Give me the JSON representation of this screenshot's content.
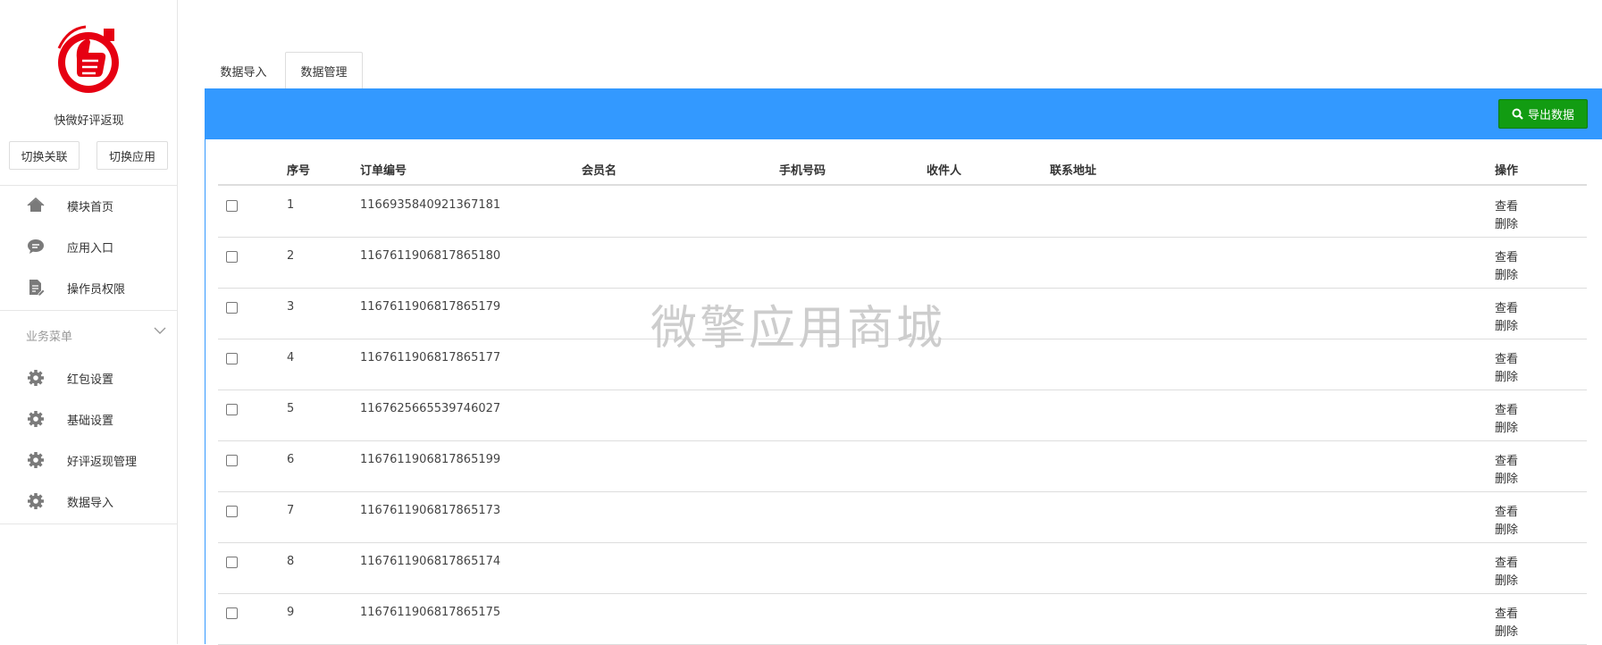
{
  "sidebar": {
    "app_name": "快微好评返现",
    "switch_link_label": "切换关联",
    "switch_app_label": "切换应用",
    "nav": [
      {
        "label": "模块首页",
        "icon": "home-icon"
      },
      {
        "label": "应用入口",
        "icon": "chat-icon"
      },
      {
        "label": "操作员权限",
        "icon": "document-edit-icon"
      }
    ],
    "section_title": "业务菜单",
    "business_nav": [
      {
        "label": "红包设置",
        "icon": "gear-icon"
      },
      {
        "label": "基础设置",
        "icon": "gear-icon"
      },
      {
        "label": "好评返现管理",
        "icon": "gear-icon"
      },
      {
        "label": "数据导入",
        "icon": "gear-icon"
      }
    ]
  },
  "tabs": [
    {
      "label": "数据导入"
    },
    {
      "label": "数据管理",
      "active": true
    }
  ],
  "toolbar": {
    "export_label": "导出数据",
    "accent": "#3399ff",
    "export_color": "#129c12"
  },
  "table": {
    "headers": [
      "序号",
      "订单编号",
      "会员名",
      "手机号码",
      "收件人",
      "联系地址",
      "操作"
    ],
    "actions": {
      "view": "查看",
      "delete": "删除"
    },
    "rows": [
      {
        "no": "1",
        "order": "1166935840921367181"
      },
      {
        "no": "2",
        "order": "1167611906817865180"
      },
      {
        "no": "3",
        "order": "1167611906817865179"
      },
      {
        "no": "4",
        "order": "1167611906817865177"
      },
      {
        "no": "5",
        "order": "1167625665539746027"
      },
      {
        "no": "6",
        "order": "1167611906817865199"
      },
      {
        "no": "7",
        "order": "1167611906817865173"
      },
      {
        "no": "8",
        "order": "1167611906817865174"
      },
      {
        "no": "9",
        "order": "1167611906817865175"
      }
    ]
  },
  "watermark": "微擎应用商城"
}
